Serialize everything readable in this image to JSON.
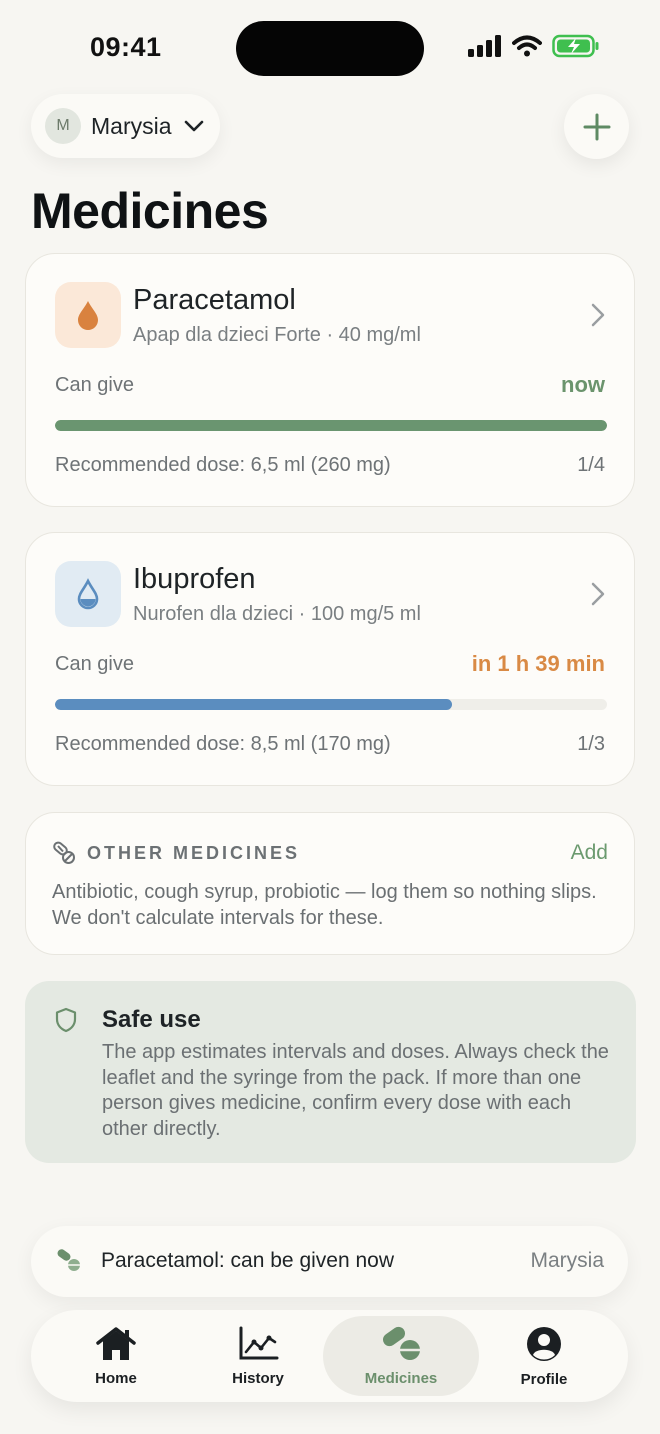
{
  "status_bar": {
    "time": "09:41"
  },
  "header": {
    "avatar_initial": "M",
    "profile_name": "Marysia",
    "title": "Medicines"
  },
  "medicines": [
    {
      "name": "Paracetamol",
      "subtitle": "Apap dla dzieci Forte · 40 mg/ml",
      "can_give_label": "Can give",
      "when": "now",
      "when_color": "#6b946d",
      "progress": 1.0,
      "bar_color": "#6a9570",
      "dose": "Recommended dose: 6,5 ml (260 mg)",
      "count": "1/4",
      "icon": "drop-icon",
      "icon_bg": "#fbe8d8",
      "icon_color": "#d9823f"
    },
    {
      "name": "Ibuprofen",
      "subtitle": "Nurofen dla dzieci · 100 mg/5 ml",
      "can_give_label": "Can give",
      "when": "in 1 h 39 min",
      "when_color": "#d98a45",
      "progress": 0.72,
      "bar_color": "#5b8dbf",
      "dose": "Recommended dose: 8,5 ml (170 mg)",
      "count": "1/3",
      "icon": "drop-outline-icon",
      "icon_bg": "#e1ebf3",
      "icon_color": "#5b8dbf"
    }
  ],
  "other_medicines": {
    "title": "OTHER MEDICINES",
    "add_label": "Add",
    "text": "Antibiotic, cough syrup, probiotic — log them so nothing slips. We don't calculate intervals for these."
  },
  "safe_use": {
    "title": "Safe use",
    "text": "The app estimates intervals and doses. Always check the leaflet and the syringe from the pack. If more than one person gives medicine, confirm every dose with each other directly."
  },
  "toast": {
    "text": "Paracetamol: can be given now",
    "person": "Marysia"
  },
  "tabs": [
    {
      "label": "Home",
      "icon": "home-icon"
    },
    {
      "label": "History",
      "icon": "chart-icon"
    },
    {
      "label": "Medicines",
      "icon": "pills-icon",
      "active": true
    },
    {
      "label": "Profile",
      "icon": "profile-icon"
    }
  ]
}
